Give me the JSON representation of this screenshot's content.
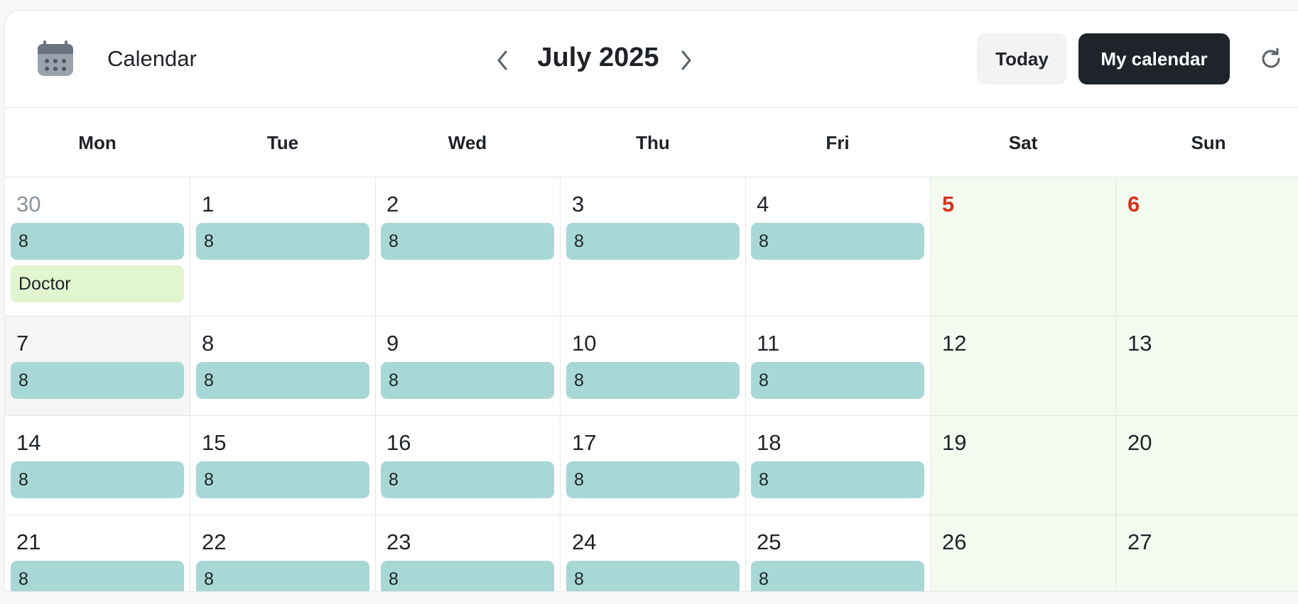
{
  "header": {
    "app_title": "Calendar",
    "month_title": "July 2025",
    "today_label": "Today",
    "my_calendar_label": "My calendar",
    "icons": {
      "app": "calendar-icon",
      "prev": "chevron-left-icon",
      "next": "chevron-right-icon",
      "refresh": "refresh-icon"
    }
  },
  "weekdays": [
    "Mon",
    "Tue",
    "Wed",
    "Thu",
    "Fri",
    "Sat",
    "Sun"
  ],
  "colors": {
    "hours_event": "#a8d8d6",
    "doctor_event": "#e1f5cf",
    "weekend_bg": "#f4faf0",
    "weekend_accent_red": "#d4321c",
    "primary_button": "#1e2429"
  },
  "weeks": [
    {
      "days": [
        {
          "day": "30",
          "style": "muted",
          "events": [
            "8",
            "Doctor"
          ]
        },
        {
          "day": "1",
          "events": [
            "8"
          ]
        },
        {
          "day": "2",
          "events": [
            "8"
          ]
        },
        {
          "day": "3",
          "events": [
            "8"
          ]
        },
        {
          "day": "4",
          "events": [
            "8"
          ]
        },
        {
          "day": "5",
          "style": "red",
          "weekend": true,
          "events": []
        },
        {
          "day": "6",
          "style": "red",
          "weekend": true,
          "events": []
        }
      ]
    },
    {
      "days": [
        {
          "day": "7",
          "highlight": true,
          "events": [
            "8"
          ]
        },
        {
          "day": "8",
          "events": [
            "8"
          ]
        },
        {
          "day": "9",
          "events": [
            "8"
          ]
        },
        {
          "day": "10",
          "events": [
            "8"
          ]
        },
        {
          "day": "11",
          "events": [
            "8"
          ]
        },
        {
          "day": "12",
          "weekend": true,
          "events": []
        },
        {
          "day": "13",
          "weekend": true,
          "events": []
        }
      ]
    },
    {
      "days": [
        {
          "day": "14",
          "events": [
            "8"
          ]
        },
        {
          "day": "15",
          "events": [
            "8"
          ]
        },
        {
          "day": "16",
          "events": [
            "8"
          ]
        },
        {
          "day": "17",
          "events": [
            "8"
          ]
        },
        {
          "day": "18",
          "events": [
            "8"
          ]
        },
        {
          "day": "19",
          "weekend": true,
          "events": []
        },
        {
          "day": "20",
          "weekend": true,
          "events": []
        }
      ]
    },
    {
      "days": [
        {
          "day": "21",
          "events": [
            "8"
          ]
        },
        {
          "day": "22",
          "events": [
            "8"
          ]
        },
        {
          "day": "23",
          "events": [
            "8"
          ]
        },
        {
          "day": "24",
          "events": [
            "8"
          ]
        },
        {
          "day": "25",
          "events": [
            "8"
          ]
        },
        {
          "day": "26",
          "weekend": true,
          "events": []
        },
        {
          "day": "27",
          "weekend": true,
          "events": []
        }
      ]
    }
  ]
}
